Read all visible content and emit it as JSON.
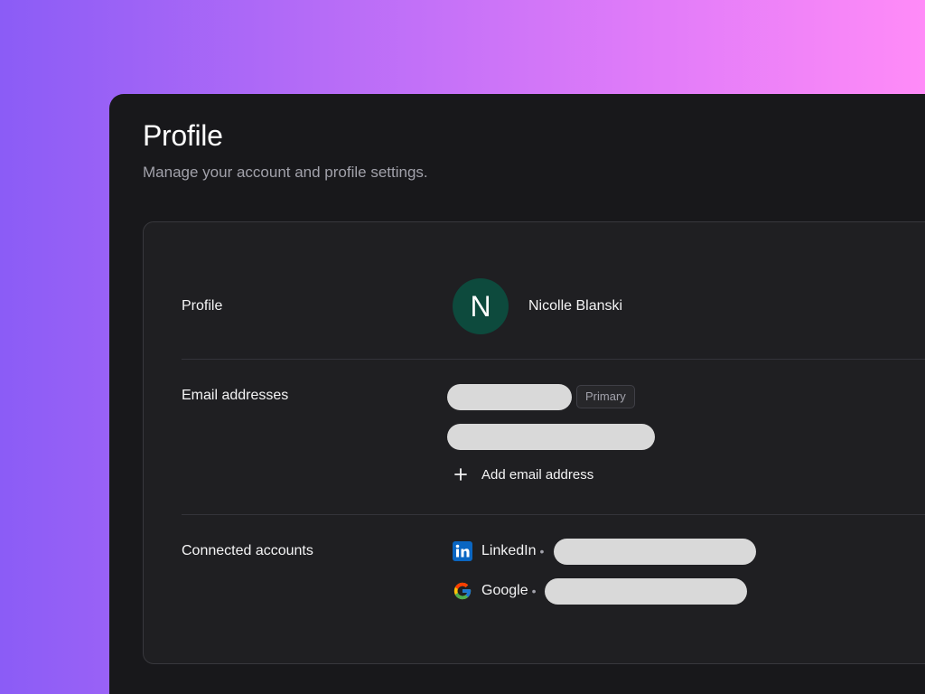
{
  "header": {
    "title": "Profile",
    "subtitle": "Manage your account and profile settings."
  },
  "profile": {
    "label": "Profile",
    "avatar_initial": "N",
    "avatar_color": "#0d4a3d",
    "name": "Nicolle Blanski"
  },
  "emails": {
    "label": "Email addresses",
    "primary_badge": "Primary",
    "add_label": "Add email address"
  },
  "connected": {
    "label": "Connected accounts",
    "accounts": [
      {
        "provider": "LinkedIn",
        "icon": "linkedin-icon",
        "separator": "•"
      },
      {
        "provider": "Google",
        "icon": "google-icon",
        "separator": "•"
      }
    ]
  },
  "colors": {
    "panel_bg": "#18181b",
    "card_bg": "#1f1f22",
    "redaction": "#d9d9d9",
    "linkedin": "#0a66c2"
  }
}
